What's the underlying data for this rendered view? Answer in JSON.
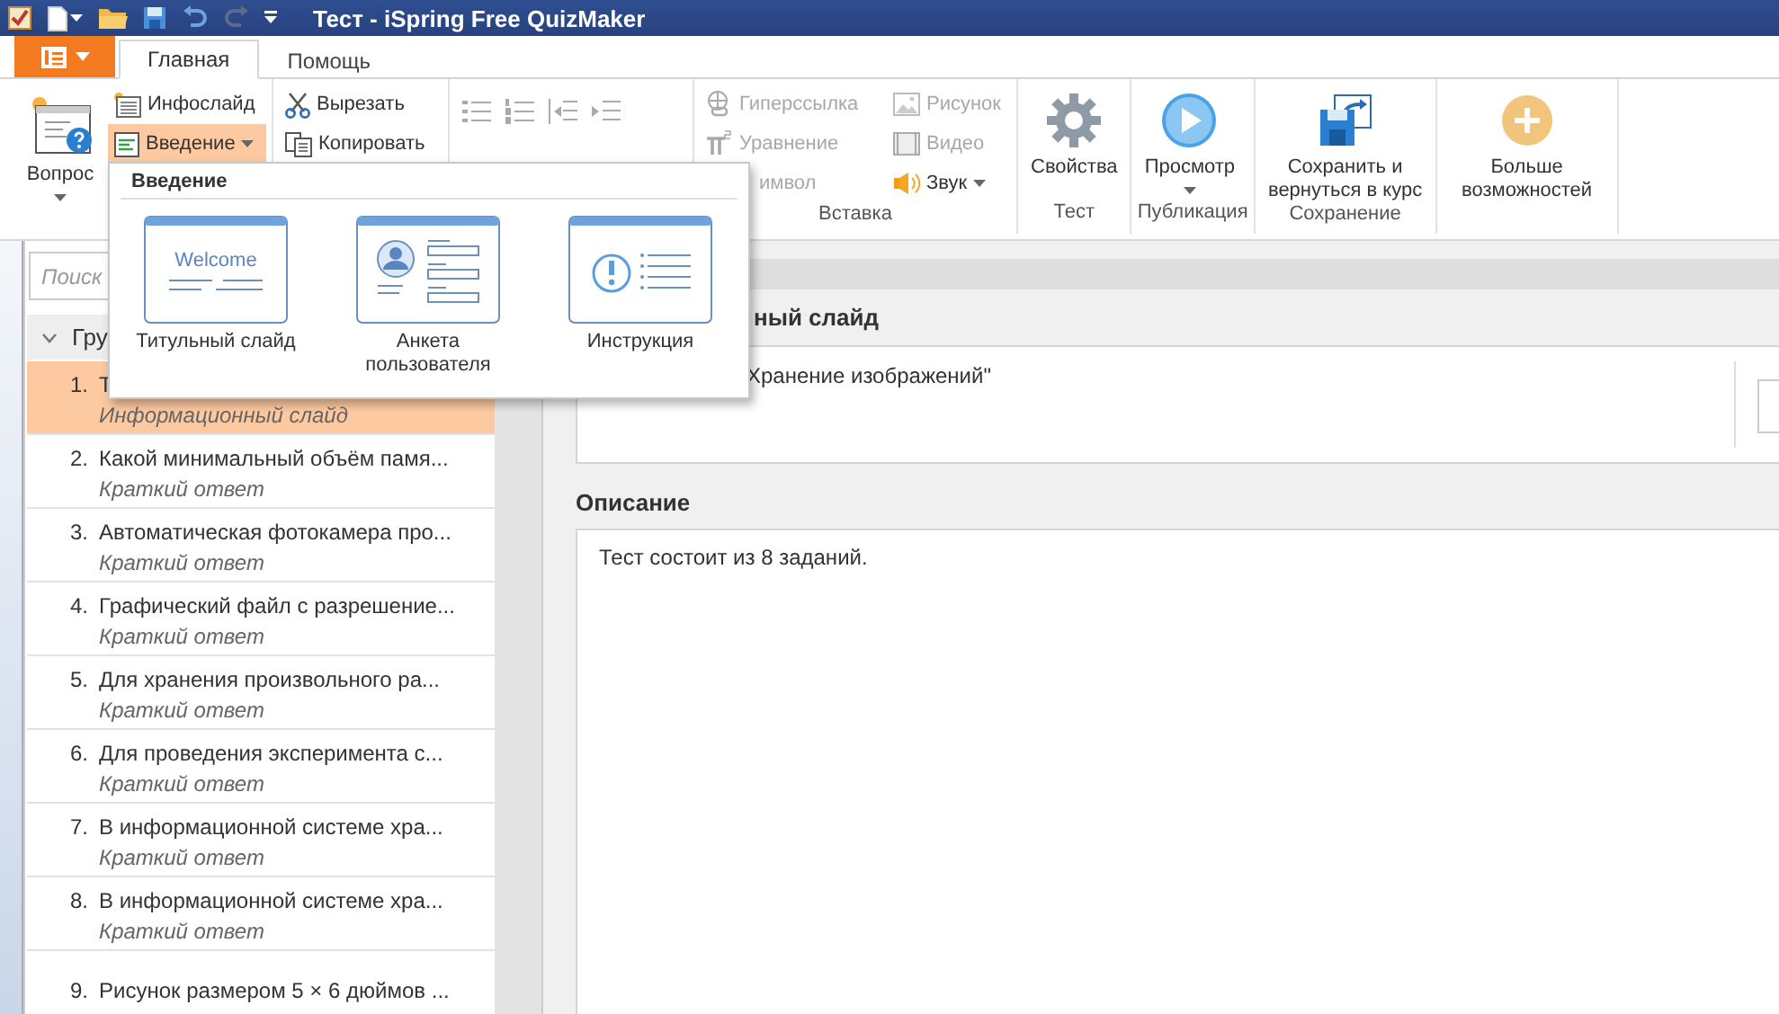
{
  "window": {
    "title": "Тест - iSpring Free QuizMaker"
  },
  "tabs": [
    {
      "label": "Главная",
      "selected": true
    },
    {
      "label": "Помощь",
      "selected": false
    }
  ],
  "ribbon": {
    "question": {
      "label": "Вопрос"
    },
    "slides": [
      {
        "label": "Инфослайд",
        "kind": "info",
        "expanded": false
      },
      {
        "label": "Введение",
        "kind": "intro",
        "expanded": true
      }
    ],
    "clipboard": [
      {
        "label": "Вырезать",
        "kind": "cut"
      },
      {
        "label": "Копировать",
        "kind": "copy"
      }
    ],
    "insert": {
      "label": "Вставка",
      "items": [
        {
          "label": "Гиперссылка",
          "kind": "link",
          "disabled": true
        },
        {
          "label": "Уравнение",
          "kind": "equation",
          "disabled": true
        },
        {
          "label": "имвол",
          "kind": "symbol",
          "disabled": true
        },
        {
          "label": "Рисунок",
          "kind": "image",
          "disabled": true
        },
        {
          "label": "Видео",
          "kind": "video",
          "disabled": true
        },
        {
          "label": "Звук",
          "kind": "sound",
          "disabled": false
        }
      ]
    },
    "groups": [
      {
        "label": "Тест",
        "button": "Свойства",
        "kind": "gear"
      },
      {
        "label": "Публикация",
        "button": "Просмотр",
        "kind": "play"
      },
      {
        "label": "Сохранение",
        "button": "Сохранить и вернуться в курс",
        "kind": "save"
      }
    ],
    "more": {
      "label": "Больше возможностей"
    }
  },
  "dropdown": {
    "title": "Введение",
    "items": [
      {
        "label": "Титульный слайд",
        "kind": "welcome",
        "preview_text": "Welcome"
      },
      {
        "label": "Анкета пользователя",
        "kind": "form"
      },
      {
        "label": "Инструкция",
        "kind": "instructions"
      }
    ]
  },
  "sidebar": {
    "search": {
      "placeholder": "Поиск"
    },
    "group": {
      "label": "Гру",
      "expanded": true
    },
    "items": [
      {
        "number": "1.",
        "title": "Т",
        "type": "Информационный слайд",
        "selected": true
      },
      {
        "number": "2.",
        "title": "Какой минимальный объём памя...",
        "type": "Краткий ответ",
        "selected": false
      },
      {
        "number": "3.",
        "title": "Автоматическая фотокамера про...",
        "type": "Краткий ответ",
        "selected": false
      },
      {
        "number": "4.",
        "title": "Графический файл с разрешение...",
        "type": "Краткий ответ",
        "selected": false
      },
      {
        "number": "5.",
        "title": "Для хранения произвольного ра...",
        "type": "Краткий ответ",
        "selected": false
      },
      {
        "number": "6.",
        "title": "Для проведения эксперимента с...",
        "type": "Краткий ответ",
        "selected": false
      },
      {
        "number": "7.",
        "title": "В информационной системе хра...",
        "type": "Краткий ответ",
        "selected": false
      },
      {
        "number": "8.",
        "title": "В информационной системе хра...",
        "type": "Краткий ответ",
        "selected": false
      },
      {
        "number": "9.",
        "title": "Рисунок размером 5 × 6 дюймов ...",
        "selected": false
      }
    ]
  },
  "editor": {
    "title_label": "ный слайд",
    "title_value": "Хранение изображений\"",
    "description_label": "Описание",
    "description_value": "Тест состоит из 8 заданий."
  }
}
